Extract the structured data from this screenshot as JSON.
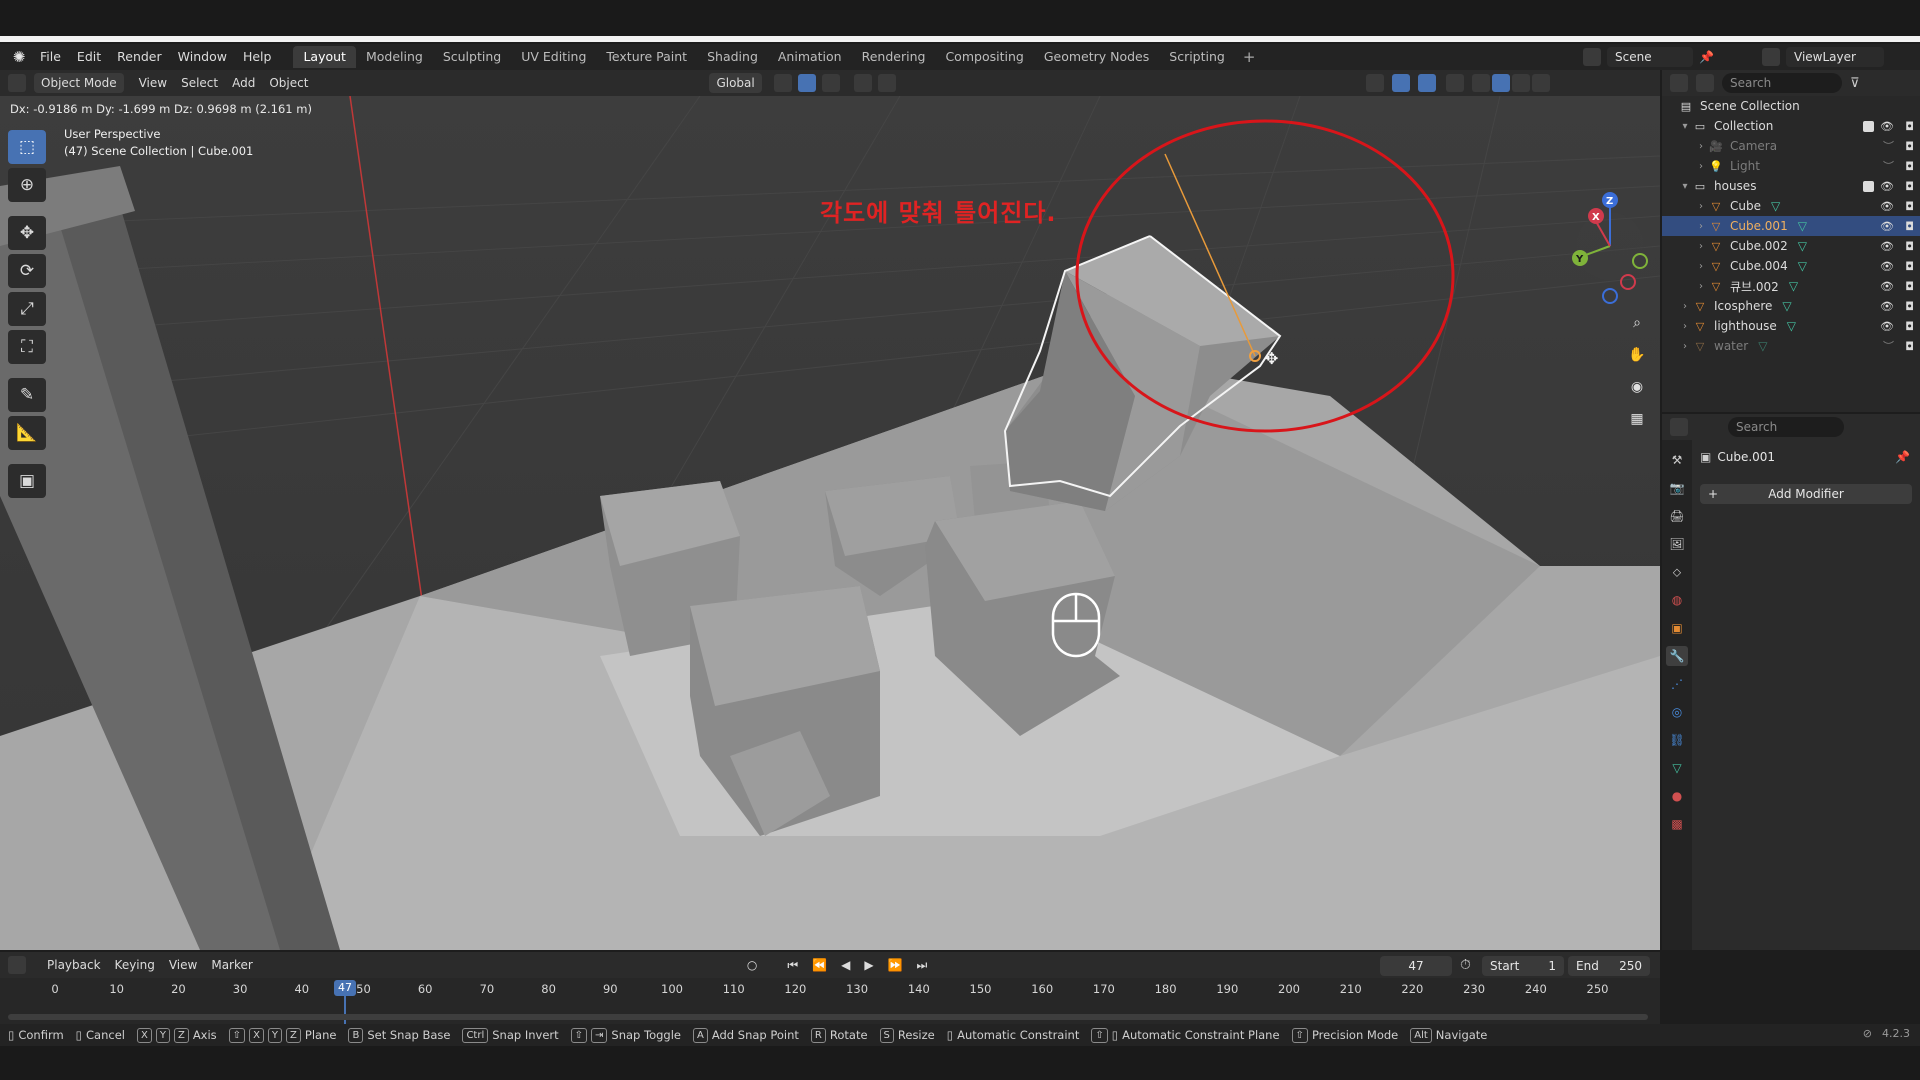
{
  "menu": {
    "items": [
      "File",
      "Edit",
      "Render",
      "Window",
      "Help"
    ],
    "workspaces": [
      "Layout",
      "Modeling",
      "Sculpting",
      "UV Editing",
      "Texture Paint",
      "Shading",
      "Animation",
      "Rendering",
      "Compositing",
      "Geometry Nodes",
      "Scripting"
    ],
    "active_workspace": "Layout",
    "scene": "Scene",
    "view_layer": "ViewLayer"
  },
  "viewport_header": {
    "mode": "Object Mode",
    "menus": [
      "View",
      "Select",
      "Add",
      "Object"
    ],
    "orientation": "Global"
  },
  "viewport": {
    "delta_readout": "Dx: -0.9186 m  Dy: -1.699 m  Dz: 0.9698 m (2.161 m)",
    "perspective": "User Perspective",
    "context": "(47) Scene Collection | Cube.001",
    "annotation_text": "각도에 맞춰 틀어진다.",
    "annotation_color": "#e02323",
    "gizmo_axes": {
      "x": "X",
      "y": "Y",
      "z": "Z"
    }
  },
  "toolbar": {
    "tools": [
      "select-box-icon",
      "cursor-icon",
      "move-icon",
      "rotate-icon",
      "scale-icon",
      "transform-icon",
      "annotate-icon",
      "measure-icon",
      "add-cube-icon"
    ],
    "active": "select-box-icon"
  },
  "outliner": {
    "search_placeholder": "Search",
    "root": "Scene Collection",
    "rows": [
      {
        "label": "Collection",
        "type": "collection"
      },
      {
        "label": "Camera",
        "type": "camera",
        "dim": true
      },
      {
        "label": "Light",
        "type": "light",
        "dim": true
      },
      {
        "label": "houses",
        "type": "collection"
      },
      {
        "label": "Cube",
        "type": "mesh"
      },
      {
        "label": "Cube.001",
        "type": "mesh",
        "selected": true
      },
      {
        "label": "Cube.002",
        "type": "mesh"
      },
      {
        "label": "Cube.004",
        "type": "mesh"
      },
      {
        "label": "큐브.002",
        "type": "mesh"
      },
      {
        "label": "Icosphere",
        "type": "mesh"
      },
      {
        "label": "lighthouse",
        "type": "mesh"
      },
      {
        "label": "water",
        "type": "mesh",
        "dim": true
      }
    ]
  },
  "properties": {
    "search_placeholder": "Search",
    "object_name": "Cube.001",
    "add_modifier": "Add Modifier"
  },
  "timeline": {
    "menus": [
      "Playback",
      "Keying",
      "View",
      "Marker"
    ],
    "current_frame": "47",
    "start_label": "Start",
    "start": "1",
    "end_label": "End",
    "end": "250",
    "ruler": [
      "0",
      "10",
      "20",
      "30",
      "40",
      "50",
      "60",
      "70",
      "80",
      "90",
      "100",
      "110",
      "120",
      "130",
      "140",
      "150",
      "160",
      "170",
      "180",
      "190",
      "200",
      "210",
      "220",
      "230",
      "240",
      "250"
    ]
  },
  "statusbar": {
    "hints": [
      "Confirm",
      "Cancel",
      "Axis",
      "Plane",
      "Set Snap Base",
      "Snap Invert",
      "Snap Toggle",
      "Add Snap Point",
      "Rotate",
      "Resize",
      "Automatic Constraint",
      "Automatic Constraint Plane",
      "Precision Mode",
      "Navigate"
    ],
    "keys": {
      "axis": [
        "X",
        "Y",
        "Z"
      ],
      "plane": [
        "X",
        "Y",
        "Z"
      ],
      "set_snap_base": "B",
      "snap_invert": "Ctrl",
      "add_snap_point": "A",
      "rotate": "R",
      "resize": "S",
      "navigate": "Alt"
    },
    "version": "4.2.3"
  },
  "colors": {
    "accent": "#4772b3",
    "selection": "#334d80",
    "mesh_icon": "#44c0a0",
    "object_icon": "#e38b33"
  }
}
